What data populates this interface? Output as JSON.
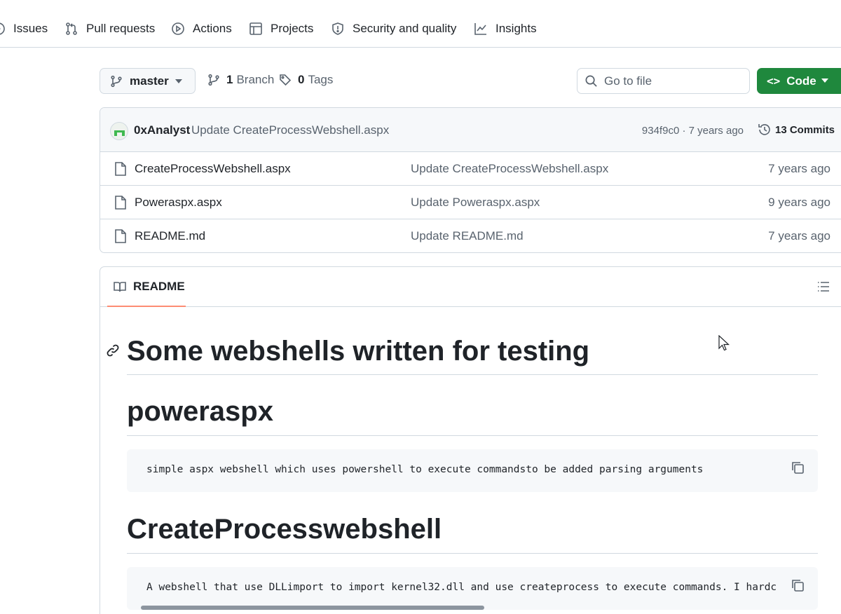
{
  "nav": {
    "items": [
      {
        "label": "Issues",
        "icon": "issue-circle-icon"
      },
      {
        "label": "Pull requests",
        "icon": "git-pull-request-icon"
      },
      {
        "label": "Actions",
        "icon": "play-circle-icon"
      },
      {
        "label": "Projects",
        "icon": "table-icon"
      },
      {
        "label": "Security and quality",
        "icon": "shield-icon"
      },
      {
        "label": "Insights",
        "icon": "graph-icon"
      }
    ]
  },
  "toolbar": {
    "branch": "master",
    "branches_count": "1",
    "branches_label": "Branch",
    "tags_count": "0",
    "tags_label": "Tags",
    "search_placeholder": "Go to file",
    "code_label": "Code"
  },
  "latest_commit": {
    "author": "0xAnalyst",
    "message": "Update CreateProcessWebshell.aspx",
    "sha_age": "934f9c0 · 7 years ago",
    "commits_label": "13 Commits"
  },
  "files": [
    {
      "name": "CreateProcessWebshell.aspx",
      "message": "Update CreateProcessWebshell.aspx",
      "age": "7 years ago"
    },
    {
      "name": "Poweraspx.aspx",
      "message": "Update Poweraspx.aspx",
      "age": "9 years ago"
    },
    {
      "name": "README.md",
      "message": "Update README.md",
      "age": "7 years ago"
    }
  ],
  "readme": {
    "tab_label": "README",
    "title": "Some webshells written for testing",
    "sections": [
      {
        "heading": "poweraspx",
        "code": "simple aspx webshell which uses powershell to execute commandsto be added parsing arguments"
      },
      {
        "heading": "CreateProcesswebshell",
        "code": "A webshell that use DLLimport to import kernel32.dll and use createprocess to execute commands. I hardc"
      }
    ]
  },
  "colors": {
    "primary_button": "#1f883d",
    "active_tab_underline": "#fd8c73",
    "border": "#d1d9e0",
    "muted_text": "#59636e"
  }
}
